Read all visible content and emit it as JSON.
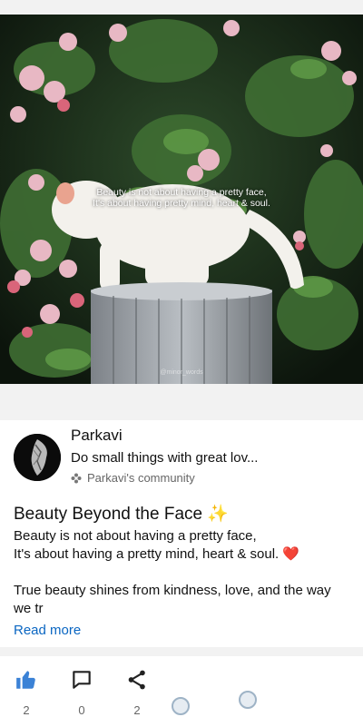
{
  "hero": {
    "quote_line1": "Beauty is not about having a pretty face,",
    "quote_line2": "It's about having pretty mind, heart & soul.",
    "watermark": "@minor_words"
  },
  "author": {
    "name": "Parkavi",
    "bio": "Do small things with great lov...",
    "community": "Parkavi's community",
    "community_icon": "flower-icon"
  },
  "post": {
    "title": "Beauty Beyond the Face ✨",
    "line1": "Beauty is not about having a pretty face,",
    "line2": "It's about having a pretty mind, heart & soul. ❤️",
    "para2": "True beauty shines from kindness, love, and the way we tr",
    "read_more": "Read more"
  },
  "actions": {
    "like": {
      "icon": "thumbs-up-icon",
      "count": "2"
    },
    "comment": {
      "icon": "comment-icon",
      "count": "0"
    },
    "share": {
      "icon": "share-icon",
      "count": "2"
    }
  },
  "colors": {
    "accent": "#0a66c2",
    "like_active": "#3b82d6",
    "muted": "#666666"
  }
}
